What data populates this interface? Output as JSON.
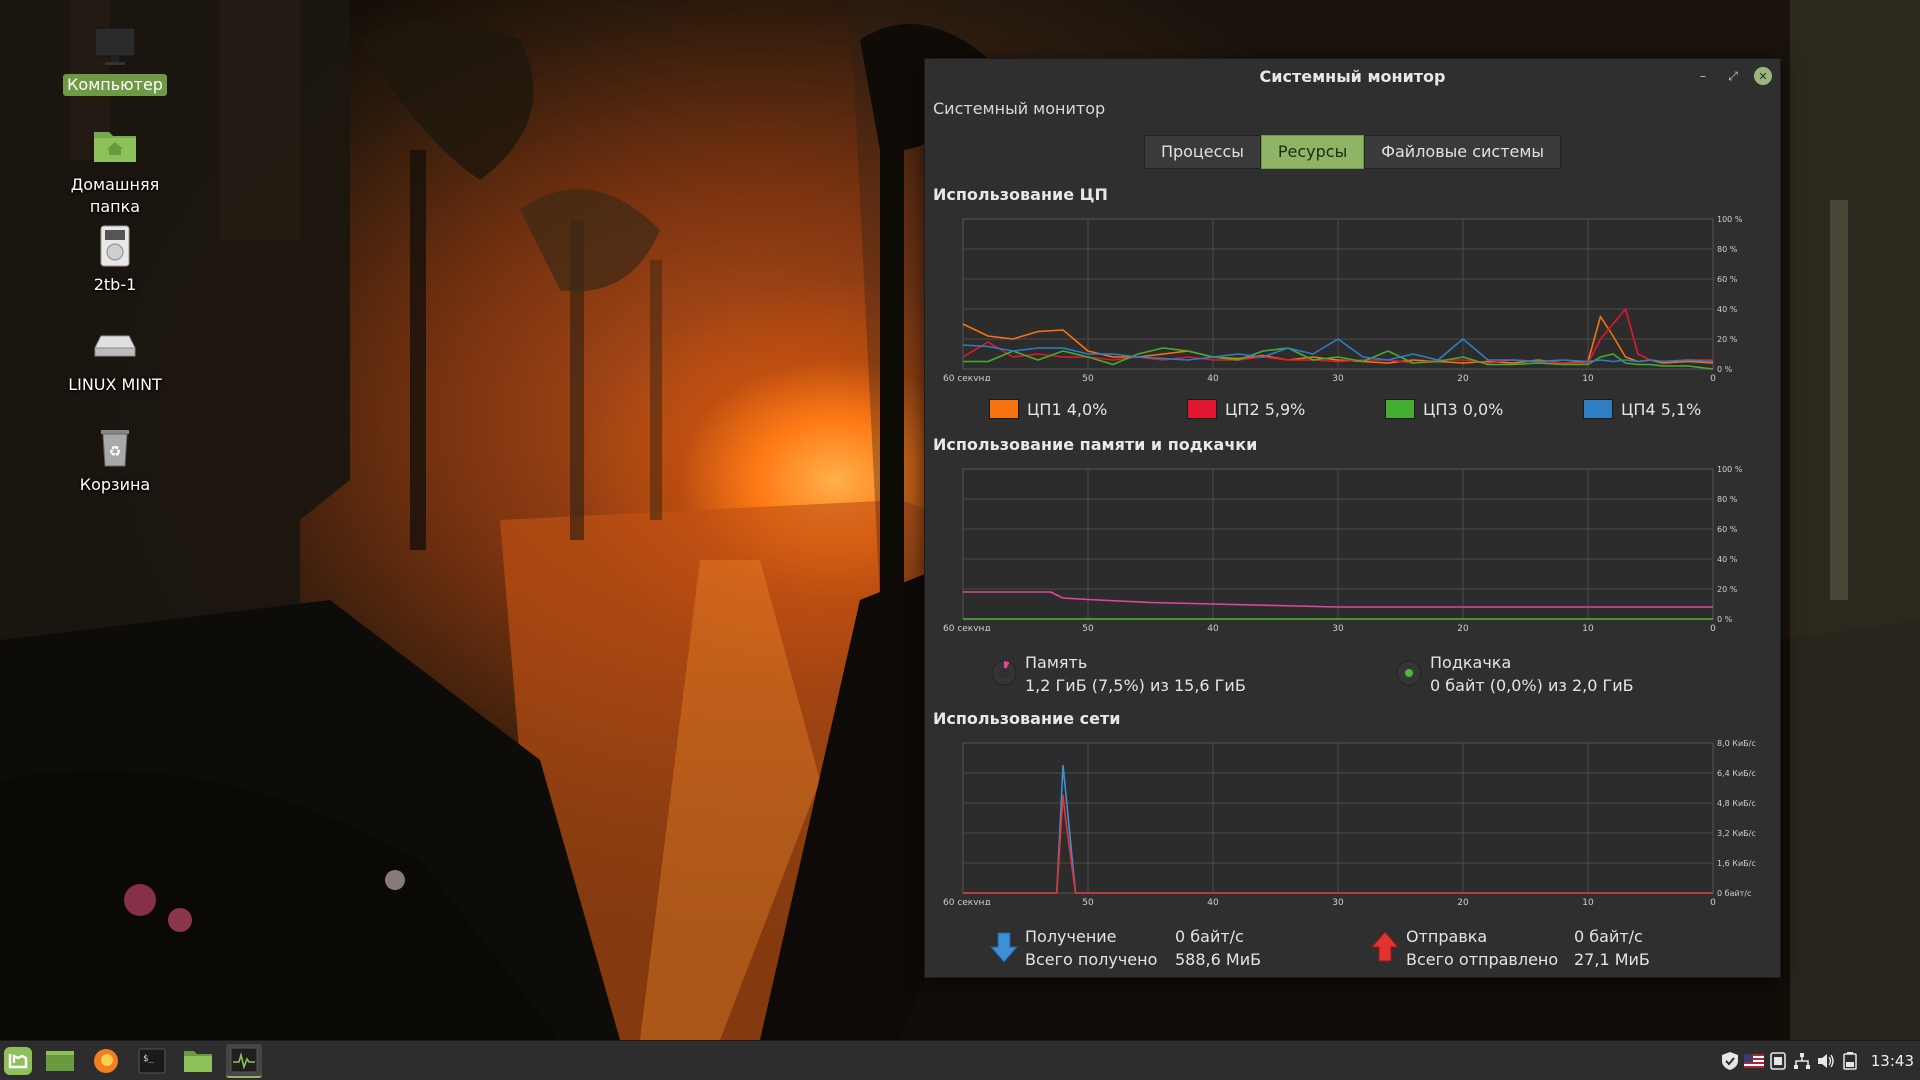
{
  "desktop": {
    "icons": [
      {
        "label": "Компьютер",
        "icon": "monitor-icon"
      },
      {
        "label": "Домашняя",
        "label2": "папка",
        "icon": "home-folder-icon"
      },
      {
        "label": "2tb-1",
        "icon": "drive-icon"
      },
      {
        "label": "LINUX MINT",
        "icon": "optical-disc-icon"
      },
      {
        "label": "Корзина",
        "icon": "trash-icon"
      }
    ]
  },
  "window": {
    "title": "Системный монитор",
    "subtitle": "Системный монитор",
    "tabs": [
      "Процессы",
      "Ресурсы",
      "Файловые системы"
    ],
    "active_tab": "Ресурсы",
    "cpu_section_title": "Использование ЦП",
    "cpu_legend": [
      {
        "name": "ЦП1",
        "value": "4,0%",
        "color": "#f5730f"
      },
      {
        "name": "ЦП2",
        "value": "5,9%",
        "color": "#e0172e"
      },
      {
        "name": "ЦП3",
        "value": "0,0%",
        "color": "#43ad2f"
      },
      {
        "name": "ЦП4",
        "value": "5,1%",
        "color": "#2e7ec4"
      }
    ],
    "mem_section_title": "Использование памяти и подкачки",
    "memory": {
      "label": "Память",
      "value": "1,2 ГиБ (7,5%) из 15,6 ГиБ",
      "color": "#e0479a"
    },
    "swap": {
      "label": "Подкачка",
      "value": "0 байт (0,0%) из 2,0 ГиБ",
      "color": "#4fb53c"
    },
    "net_section_title": "Использование сети",
    "receive": {
      "label": "Получение",
      "rate": "0 байт/с",
      "total_label": "Всего получено",
      "total": "588,6 МиБ",
      "color": "#3d8fd6"
    },
    "send": {
      "label": "Отправка",
      "rate": "0 байт/с",
      "total_label": "Всего отправлено",
      "total": "27,1 МиБ",
      "color": "#e23232"
    },
    "x_ticks": [
      "60 секунд",
      "50",
      "40",
      "30",
      "20",
      "10",
      "0"
    ],
    "percent_ticks": [
      "100 %",
      "80 %",
      "60 %",
      "40 %",
      "20 %",
      "0 %"
    ],
    "net_ticks": [
      "8,0 КиБ/с",
      "6,4 КиБ/с",
      "4,8 КиБ/с",
      "3,2 КиБ/с",
      "1,6 КиБ/с",
      "0 байт/с"
    ]
  },
  "chart_data": [
    {
      "type": "line",
      "title": "Использование ЦП",
      "x": [
        60,
        58,
        56,
        54,
        52,
        50,
        48,
        46,
        44,
        42,
        40,
        38,
        36,
        34,
        32,
        30,
        28,
        26,
        24,
        22,
        20,
        18,
        16,
        14,
        12,
        10,
        9,
        8,
        7,
        6,
        5,
        4,
        2,
        0
      ],
      "ylim": [
        0,
        100
      ],
      "series": [
        {
          "name": "ЦП1",
          "values": [
            30,
            22,
            20,
            25,
            26,
            12,
            8,
            8,
            10,
            12,
            8,
            7,
            9,
            6,
            8,
            6,
            5,
            4,
            6,
            5,
            4,
            5,
            4,
            6,
            4,
            5,
            35,
            22,
            8,
            5,
            6,
            4,
            5,
            4
          ]
        },
        {
          "name": "ЦП2",
          "values": [
            8,
            18,
            8,
            10,
            8,
            8,
            6,
            8,
            6,
            8,
            6,
            6,
            8,
            6,
            6,
            5,
            6,
            6,
            4,
            6,
            6,
            4,
            6,
            5,
            4,
            4,
            20,
            30,
            40,
            10,
            6,
            5,
            6,
            6
          ]
        },
        {
          "name": "ЦП3",
          "values": [
            5,
            5,
            12,
            6,
            12,
            8,
            3,
            10,
            14,
            12,
            8,
            6,
            12,
            14,
            6,
            8,
            5,
            12,
            4,
            5,
            8,
            3,
            3,
            4,
            3,
            3,
            8,
            10,
            4,
            3,
            3,
            2,
            2,
            0
          ]
        },
        {
          "name": "ЦП4",
          "values": [
            16,
            15,
            12,
            14,
            14,
            10,
            10,
            8,
            7,
            6,
            8,
            10,
            8,
            14,
            10,
            20,
            8,
            6,
            10,
            6,
            20,
            6,
            6,
            5,
            6,
            5,
            6,
            5,
            6,
            5,
            6,
            5,
            6,
            5
          ]
        }
      ]
    },
    {
      "type": "line",
      "title": "Использование памяти и подкачки",
      "x": [
        60,
        54,
        53,
        52,
        50,
        45,
        40,
        35,
        30,
        20,
        10,
        0
      ],
      "ylim": [
        0,
        100
      ],
      "series": [
        {
          "name": "Память",
          "values": [
            18,
            18,
            18,
            14,
            13,
            11,
            10,
            9,
            8,
            8,
            8,
            8
          ]
        },
        {
          "name": "Подкачка",
          "values": [
            0,
            0,
            0,
            0,
            0,
            0,
            0,
            0,
            0,
            0,
            0,
            0
          ]
        }
      ]
    },
    {
      "type": "line",
      "title": "Использование сети",
      "x": [
        60,
        56,
        54,
        52.5,
        52,
        51.8,
        51,
        50,
        40,
        30,
        20,
        10,
        0
      ],
      "ylim": [
        0,
        8.0
      ],
      "ylabel": "КиБ/с",
      "series": [
        {
          "name": "Получение",
          "values": [
            0,
            0,
            0,
            0,
            6.8,
            5.5,
            0,
            0,
            0,
            0,
            0,
            0,
            0
          ]
        },
        {
          "name": "Отправка",
          "values": [
            0,
            0,
            0,
            0,
            5.2,
            4.0,
            0,
            0,
            0,
            0,
            0,
            0,
            0
          ]
        }
      ]
    }
  ],
  "taskbar": {
    "buttons": [
      "mint-menu-icon",
      "show-desktop-icon",
      "firefox-icon",
      "terminal-icon",
      "files-icon",
      "system-monitor-icon"
    ],
    "tray": [
      "shield-icon",
      "keyboard-layout-icon",
      "update-manager-icon",
      "network-icon",
      "volume-icon",
      "battery-icon"
    ],
    "clock": "13:43"
  }
}
